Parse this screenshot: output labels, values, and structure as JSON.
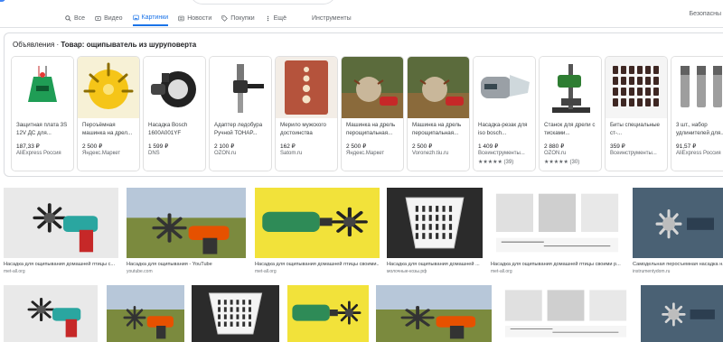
{
  "tabs": [
    {
      "label": "Все",
      "icon": "search-icon"
    },
    {
      "label": "Видео",
      "icon": "video-icon"
    },
    {
      "label": "Картинки",
      "icon": "image-icon",
      "active": true
    },
    {
      "label": "Новости",
      "icon": "news-icon"
    },
    {
      "label": "Покупки",
      "icon": "tag-icon"
    },
    {
      "label": "Ещё",
      "icon": "more-icon"
    }
  ],
  "tools_label": "Инструменты",
  "safe_search_label": "Безопасны",
  "shopping": {
    "ads_label": "Объявления",
    "title": "Товар: ощипыватель из шуруповерта",
    "products": [
      {
        "name": "Защитная плата 3S 12V ДС для...",
        "price": "187,33 ₽",
        "store": "AliExpress Россия",
        "icon": "circuit-board-image"
      },
      {
        "name": "Пероъёмная машинка на дрел...",
        "price": "2 500 ₽",
        "store": "Яндекс.Маркет",
        "icon": "plucker-yellow-image"
      },
      {
        "name": "Насадка Bosch 1600A001YF",
        "price": "1 599 ₽",
        "store": "DNS",
        "icon": "bosch-attachment-image"
      },
      {
        "name": "Адаптер ледобура Ручной ТОНАР...",
        "price": "2 100 ₽",
        "store": "OZON.ru",
        "icon": "adapter-image"
      },
      {
        "name": "Мерило мужского достоинства",
        "price": "162 ₽",
        "store": "Satom.ru",
        "icon": "wood-board-image"
      },
      {
        "name": "Машинка на дрель перощипальная...",
        "price": "2 500 ₽",
        "store": "Яндекс.Маркет",
        "icon": "plucker-in-use-image"
      },
      {
        "name": "Машинка на дрель перощипальная...",
        "price": "2 500 ₽",
        "store": "Voronezh.tiu.ru",
        "icon": "plucker-in-use-image"
      },
      {
        "name": "Насадка-резак для iso bosch...",
        "price": "1 409 ₽",
        "store": "Всеинструменты...",
        "rating": "★★★★★ (39)",
        "icon": "cutter-image"
      },
      {
        "name": "Станок для дрели с тисками...",
        "price": "2 880 ₽",
        "store": "OZON.ru",
        "rating": "★★★★★ (30)",
        "icon": "drill-stand-image"
      },
      {
        "name": "Биты специальные ст-...",
        "price": "359 ₽",
        "store": "Всеинструменты...",
        "icon": "bits-set-image"
      },
      {
        "name": "3 шт., набор удлинителей для...",
        "price": "91,57 ₽",
        "store": "AliExpress Россия",
        "icon": "socket-extenders-image"
      }
    ]
  },
  "images_row1": [
    {
      "caption": "Насадка для ощипывания домашней птицы с...",
      "source": "met-all.org"
    },
    {
      "caption": "Насадка для ощипывания - YouTube",
      "source": "youtube.com"
    },
    {
      "caption": "Насадка для ощипывания домашней птицы своими...",
      "source": "met-all.org"
    },
    {
      "caption": "Насадка для ощипывания домашней ...",
      "source": "молочные-козы.рф"
    },
    {
      "caption": "Насадка для ощипывания домашней птицы своими р...",
      "source": "met-all.org"
    },
    {
      "caption": "Самодельная перосъемная насадка н...",
      "source": "instrumentydom.ru"
    }
  ],
  "colors": {
    "accent": "#1a73e8",
    "drill_green": "#2e8b57",
    "drill_teal": "#2aa6a0"
  }
}
